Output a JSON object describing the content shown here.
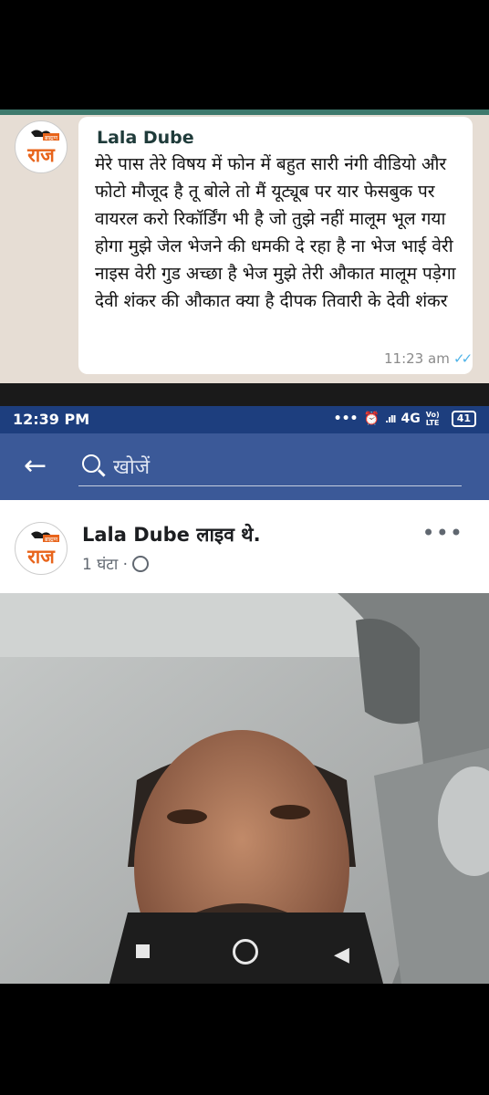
{
  "whatsapp": {
    "name": "Lala Dube",
    "message": "मेरे पास तेरे विषय में फोन में बहुत सारी नंगी वीडियो और फोटो मौजूद है तू बोले तो मैं यूट्यूब पर यार फेसबुक पर वायरल करो रिकॉर्डिंग भी है जो तुझे नहीं मालूम भूल गया होगा मुझे जेल भेजने की धमकी दे रहा है ना भेज भाई वेरी नाइस वेरी गुड अच्छा है भेज मुझे तेरी औकात मालूम पड़ेगा देवी शंकर की औकात क्या है दीपक तिवारी के देवी शंकर",
    "time": "11:23 am",
    "ticks": "✓✓"
  },
  "logo": {
    "top": "ब्राह्मण",
    "main": "राज"
  },
  "status_bar": {
    "time": "12:39 PM",
    "dots": "•••",
    "network": "4G",
    "network_sub": "Vo) LTE",
    "battery": "41"
  },
  "facebook": {
    "back": "←",
    "search_placeholder": "खोजें",
    "post_title": "Lala Dube लाइव थे.",
    "post_time": "1 घंटा ·",
    "menu_dots": "•••"
  },
  "colors": {
    "wa_bg": "#e6ddd4",
    "fb_header": "#3b5998",
    "status_bar": "#1d3e7e"
  }
}
